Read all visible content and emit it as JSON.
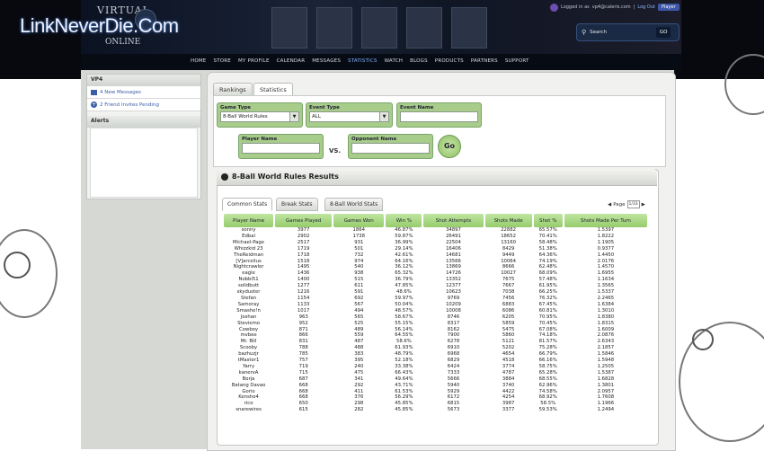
{
  "header": {
    "watermark": "LinkNeverDie.Com",
    "logo_top": "VIRTUAL",
    "logo_bottom": "ONLINE",
    "login_text": "Logged in as",
    "login_email": "vp4@caleris.com",
    "logout_label": "Log Out",
    "player_label": "Player",
    "search_placeholder": "Search",
    "search_go_label": "GO",
    "nav": [
      "HOME",
      "STORE",
      "MY PROFILE",
      "CALENDAR",
      "MESSAGES",
      "STATISTICS",
      "WATCH",
      "BLOGS",
      "PRODUCTS",
      "PARTNERS",
      "SUPPORT"
    ],
    "nav_active": "STATISTICS"
  },
  "sidebar": {
    "title": "VP4",
    "items": [
      "4 New Messages",
      "2 Friend Invites Pending"
    ],
    "alerts_title": "Alerts"
  },
  "tabs": [
    "Rankings",
    "Statistics"
  ],
  "filters": {
    "game_type_label": "Game Type",
    "game_type_value": "8-Ball World Rules",
    "event_type_label": "Event Type",
    "event_type_value": "ALL",
    "event_name_label": "Event Name",
    "player_name_label": "Player Name",
    "vs_label": "VS.",
    "opponent_name_label": "Opponent Name",
    "go_label": "Go"
  },
  "results": {
    "title": "8-Ball World Rules Results",
    "subtabs": [
      "Common Stats",
      "Break Stats",
      "8-Ball World Stats"
    ],
    "page_label": "Page",
    "page_value": "1/33",
    "columns": [
      "Player Name",
      "Games Played",
      "Games Won",
      "Win %",
      "Shot Attempts",
      "Shots Made",
      "Shot %",
      "Shots Made Per Turn"
    ],
    "rows": [
      [
        "sonny",
        "3977",
        "1864",
        "46.87%",
        "34897",
        "22882",
        "65.57%",
        "1.5397"
      ],
      [
        "Edbal",
        "2902",
        "1738",
        "59.87%",
        "26491",
        "18652",
        "70.41%",
        "1.8222"
      ],
      [
        "Michael-Page",
        "2517",
        "931",
        "36.99%",
        "22504",
        "13160",
        "58.48%",
        "1.1905"
      ],
      [
        "Whizzkid 23",
        "1719",
        "501",
        "29.14%",
        "16406",
        "8429",
        "51.38%",
        "0.9377"
      ],
      [
        "TheReidman",
        "1718",
        "732",
        "42.61%",
        "14681",
        "9449",
        "64.36%",
        "1.4450"
      ],
      [
        "[V]arcellus",
        "1518",
        "974",
        "64.16%",
        "13566",
        "10064",
        "74.19%",
        "2.0176"
      ],
      [
        "Nightcrawler",
        "1495",
        "540",
        "36.12%",
        "13869",
        "8666",
        "62.48%",
        "1.4570"
      ],
      [
        "eagle",
        "1436",
        "938",
        "65.32%",
        "14726",
        "10027",
        "68.09%",
        "1.6955"
      ],
      [
        "Nobbi51",
        "1400",
        "515",
        "36.79%",
        "13352",
        "7675",
        "57.48%",
        "1.1634"
      ],
      [
        "solidbutt",
        "1277",
        "611",
        "47.85%",
        "12377",
        "7667",
        "61.95%",
        "1.3565"
      ],
      [
        "skyduster",
        "1216",
        "591",
        "48.6%",
        "10623",
        "7038",
        "66.25%",
        "1.5337"
      ],
      [
        "Stefan",
        "1154",
        "692",
        "59.97%",
        "9769",
        "7456",
        "76.32%",
        "2.2465"
      ],
      [
        "Samoray",
        "1133",
        "567",
        "50.04%",
        "10209",
        "6883",
        "67.45%",
        "1.6384"
      ],
      [
        "Smashe!n",
        "1017",
        "494",
        "48.57%",
        "10008",
        "6086",
        "60.81%",
        "1.3010"
      ],
      [
        "Joshan",
        "963",
        "565",
        "58.67%",
        "8746",
        "6205",
        "70.95%",
        "1.8380"
      ],
      [
        "Steviemo",
        "952",
        "525",
        "55.15%",
        "8317",
        "5859",
        "70.45%",
        "1.8315"
      ],
      [
        "Cowboy",
        "871",
        "489",
        "56.14%",
        "8162",
        "5475",
        "67.08%",
        "1.6009"
      ],
      [
        "mvbee",
        "866",
        "559",
        "64.55%",
        "7900",
        "5860",
        "74.18%",
        "2.0876"
      ],
      [
        "Mr. Bill",
        "831",
        "487",
        "58.6%",
        "6278",
        "5121",
        "81.57%",
        "2.6343"
      ],
      [
        "Scooby",
        "788",
        "488",
        "61.93%",
        "6910",
        "5202",
        "75.28%",
        "2.1857"
      ],
      [
        "bazhuzjr",
        "785",
        "383",
        "48.79%",
        "6968",
        "4654",
        "66.79%",
        "1.5846"
      ],
      [
        "tMaster1",
        "757",
        "395",
        "52.18%",
        "6829",
        "4518",
        "66.16%",
        "1.5948"
      ],
      [
        "Yarry",
        "719",
        "240",
        "33.38%",
        "6424",
        "3774",
        "58.75%",
        "1.2505"
      ],
      [
        "kanervA",
        "715",
        "475",
        "66.43%",
        "7333",
        "4787",
        "65.28%",
        "1.5387"
      ],
      [
        "Borja",
        "687",
        "341",
        "49.64%",
        "5666",
        "3884",
        "68.55%",
        "1.6828"
      ],
      [
        "Batang Davao",
        "668",
        "292",
        "43.71%",
        "5940",
        "3740",
        "62.96%",
        "1.3801"
      ],
      [
        "Gorio",
        "668",
        "411",
        "61.53%",
        "5929",
        "4422",
        "74.58%",
        "2.0957"
      ],
      [
        "Kensho4",
        "668",
        "376",
        "56.29%",
        "6172",
        "4254",
        "68.92%",
        "1.7608"
      ],
      [
        "rico",
        "650",
        "298",
        "45.85%",
        "6815",
        "3987",
        "58.5%",
        "1.1966"
      ],
      [
        "snarewires",
        "615",
        "282",
        "45.85%",
        "5673",
        "3377",
        "59.53%",
        "1.2494"
      ]
    ]
  },
  "colors": {
    "header_bg": "#07090f",
    "accent_green": "#a8cc8a",
    "link_blue": "#3a5ea8"
  }
}
